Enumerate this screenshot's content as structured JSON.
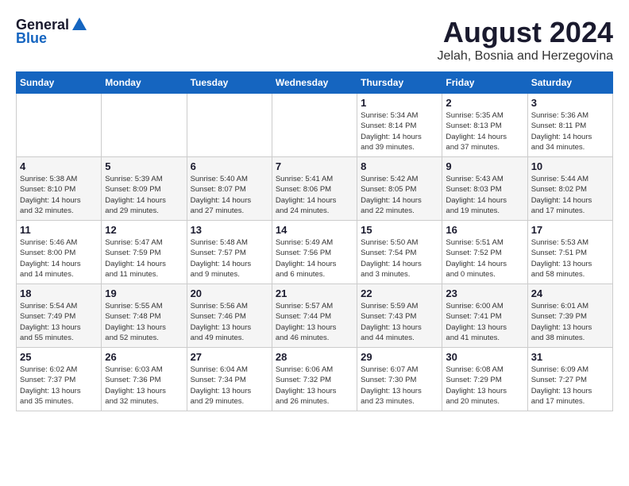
{
  "header": {
    "logo_general": "General",
    "logo_blue": "Blue",
    "month": "August 2024",
    "location": "Jelah, Bosnia and Herzegovina"
  },
  "days_of_week": [
    "Sunday",
    "Monday",
    "Tuesday",
    "Wednesday",
    "Thursday",
    "Friday",
    "Saturday"
  ],
  "weeks": [
    [
      {
        "day": "",
        "info": ""
      },
      {
        "day": "",
        "info": ""
      },
      {
        "day": "",
        "info": ""
      },
      {
        "day": "",
        "info": ""
      },
      {
        "day": "1",
        "info": "Sunrise: 5:34 AM\nSunset: 8:14 PM\nDaylight: 14 hours\nand 39 minutes."
      },
      {
        "day": "2",
        "info": "Sunrise: 5:35 AM\nSunset: 8:13 PM\nDaylight: 14 hours\nand 37 minutes."
      },
      {
        "day": "3",
        "info": "Sunrise: 5:36 AM\nSunset: 8:11 PM\nDaylight: 14 hours\nand 34 minutes."
      }
    ],
    [
      {
        "day": "4",
        "info": "Sunrise: 5:38 AM\nSunset: 8:10 PM\nDaylight: 14 hours\nand 32 minutes."
      },
      {
        "day": "5",
        "info": "Sunrise: 5:39 AM\nSunset: 8:09 PM\nDaylight: 14 hours\nand 29 minutes."
      },
      {
        "day": "6",
        "info": "Sunrise: 5:40 AM\nSunset: 8:07 PM\nDaylight: 14 hours\nand 27 minutes."
      },
      {
        "day": "7",
        "info": "Sunrise: 5:41 AM\nSunset: 8:06 PM\nDaylight: 14 hours\nand 24 minutes."
      },
      {
        "day": "8",
        "info": "Sunrise: 5:42 AM\nSunset: 8:05 PM\nDaylight: 14 hours\nand 22 minutes."
      },
      {
        "day": "9",
        "info": "Sunrise: 5:43 AM\nSunset: 8:03 PM\nDaylight: 14 hours\nand 19 minutes."
      },
      {
        "day": "10",
        "info": "Sunrise: 5:44 AM\nSunset: 8:02 PM\nDaylight: 14 hours\nand 17 minutes."
      }
    ],
    [
      {
        "day": "11",
        "info": "Sunrise: 5:46 AM\nSunset: 8:00 PM\nDaylight: 14 hours\nand 14 minutes."
      },
      {
        "day": "12",
        "info": "Sunrise: 5:47 AM\nSunset: 7:59 PM\nDaylight: 14 hours\nand 11 minutes."
      },
      {
        "day": "13",
        "info": "Sunrise: 5:48 AM\nSunset: 7:57 PM\nDaylight: 14 hours\nand 9 minutes."
      },
      {
        "day": "14",
        "info": "Sunrise: 5:49 AM\nSunset: 7:56 PM\nDaylight: 14 hours\nand 6 minutes."
      },
      {
        "day": "15",
        "info": "Sunrise: 5:50 AM\nSunset: 7:54 PM\nDaylight: 14 hours\nand 3 minutes."
      },
      {
        "day": "16",
        "info": "Sunrise: 5:51 AM\nSunset: 7:52 PM\nDaylight: 14 hours\nand 0 minutes."
      },
      {
        "day": "17",
        "info": "Sunrise: 5:53 AM\nSunset: 7:51 PM\nDaylight: 13 hours\nand 58 minutes."
      }
    ],
    [
      {
        "day": "18",
        "info": "Sunrise: 5:54 AM\nSunset: 7:49 PM\nDaylight: 13 hours\nand 55 minutes."
      },
      {
        "day": "19",
        "info": "Sunrise: 5:55 AM\nSunset: 7:48 PM\nDaylight: 13 hours\nand 52 minutes."
      },
      {
        "day": "20",
        "info": "Sunrise: 5:56 AM\nSunset: 7:46 PM\nDaylight: 13 hours\nand 49 minutes."
      },
      {
        "day": "21",
        "info": "Sunrise: 5:57 AM\nSunset: 7:44 PM\nDaylight: 13 hours\nand 46 minutes."
      },
      {
        "day": "22",
        "info": "Sunrise: 5:59 AM\nSunset: 7:43 PM\nDaylight: 13 hours\nand 44 minutes."
      },
      {
        "day": "23",
        "info": "Sunrise: 6:00 AM\nSunset: 7:41 PM\nDaylight: 13 hours\nand 41 minutes."
      },
      {
        "day": "24",
        "info": "Sunrise: 6:01 AM\nSunset: 7:39 PM\nDaylight: 13 hours\nand 38 minutes."
      }
    ],
    [
      {
        "day": "25",
        "info": "Sunrise: 6:02 AM\nSunset: 7:37 PM\nDaylight: 13 hours\nand 35 minutes."
      },
      {
        "day": "26",
        "info": "Sunrise: 6:03 AM\nSunset: 7:36 PM\nDaylight: 13 hours\nand 32 minutes."
      },
      {
        "day": "27",
        "info": "Sunrise: 6:04 AM\nSunset: 7:34 PM\nDaylight: 13 hours\nand 29 minutes."
      },
      {
        "day": "28",
        "info": "Sunrise: 6:06 AM\nSunset: 7:32 PM\nDaylight: 13 hours\nand 26 minutes."
      },
      {
        "day": "29",
        "info": "Sunrise: 6:07 AM\nSunset: 7:30 PM\nDaylight: 13 hours\nand 23 minutes."
      },
      {
        "day": "30",
        "info": "Sunrise: 6:08 AM\nSunset: 7:29 PM\nDaylight: 13 hours\nand 20 minutes."
      },
      {
        "day": "31",
        "info": "Sunrise: 6:09 AM\nSunset: 7:27 PM\nDaylight: 13 hours\nand 17 minutes."
      }
    ]
  ]
}
